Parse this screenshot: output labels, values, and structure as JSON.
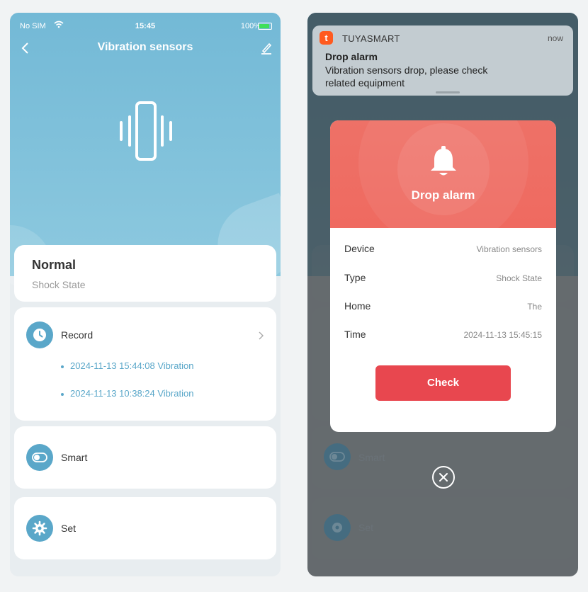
{
  "left": {
    "status": {
      "carrier": "No SIM",
      "time": "15:45",
      "battery": "100%",
      "battery_fraction": 1.0
    },
    "nav": {
      "title": "Vibration sensors"
    },
    "state_card": {
      "title": "Normal",
      "subtitle": "Shock State"
    },
    "record": {
      "label": "Record",
      "items": [
        "2024-11-13 15:44:08 Vibration",
        "2024-11-13 10:38:24 Vibration"
      ]
    },
    "smart": {
      "label": "Smart"
    },
    "set": {
      "label": "Set"
    },
    "colors": {
      "header": "#73b9d6",
      "accent": "#5aa7c9"
    }
  },
  "right": {
    "notification": {
      "app": "TUYASMART",
      "time": "now",
      "title": "Drop alarm",
      "body": "Vibration sensors drop, please check related equipment"
    },
    "modal": {
      "title": "Drop alarm",
      "rows": [
        {
          "key": "Device",
          "value": "Vibration sensors"
        },
        {
          "key": "Type",
          "value": "Shock State"
        },
        {
          "key": "Home",
          "value": "The"
        },
        {
          "key": "Time",
          "value": "2024-11-13 15:45:15"
        }
      ],
      "check_label": "Check"
    },
    "background": {
      "smart_label": "Smart",
      "set_label": "Set"
    },
    "colors": {
      "header": "#ef6a60",
      "button": "#e8474f"
    }
  }
}
